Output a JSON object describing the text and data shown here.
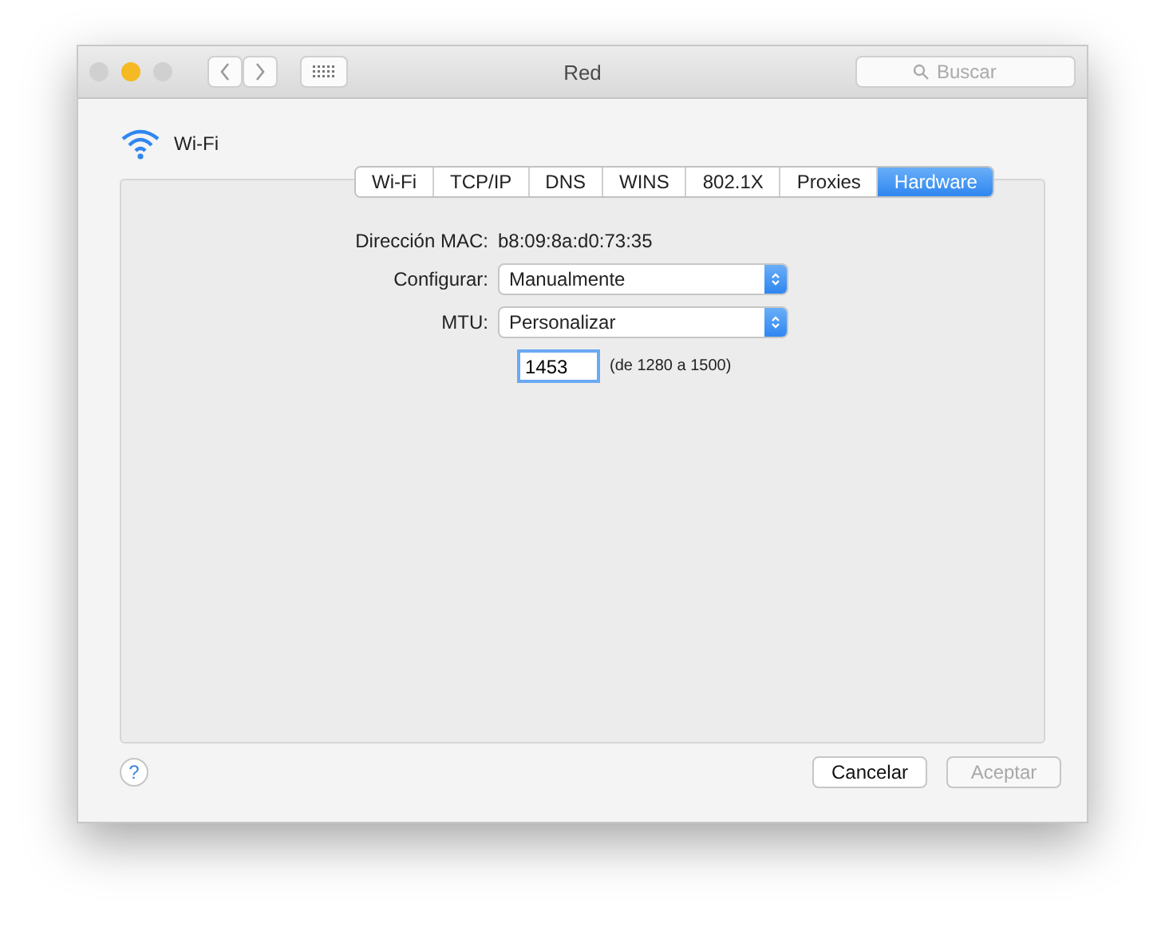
{
  "window": {
    "title": "Red",
    "traffic_lights": [
      {
        "color": "#d0d0d0"
      },
      {
        "color": "#f5b923"
      },
      {
        "color": "#d0d0d0"
      }
    ],
    "search": {
      "placeholder": "Buscar"
    }
  },
  "header": {
    "title": "Wi-Fi"
  },
  "tabs": [
    {
      "label": "Wi-Fi",
      "selected": false
    },
    {
      "label": "TCP/IP",
      "selected": false
    },
    {
      "label": "DNS",
      "selected": false
    },
    {
      "label": "WINS",
      "selected": false
    },
    {
      "label": "802.1X",
      "selected": false
    },
    {
      "label": "Proxies",
      "selected": false
    },
    {
      "label": "Hardware",
      "selected": true
    }
  ],
  "rows": [
    {
      "kind": "text",
      "label": "Dirección MAC:",
      "value": "b8:09:8a:d0:73:35"
    },
    {
      "kind": "popup",
      "label": "Configurar:",
      "value": "Manualmente"
    },
    {
      "kind": "popup",
      "label": "MTU:",
      "value": "Personalizar"
    },
    {
      "kind": "field",
      "value": "1453",
      "hint": "(de 1280 a 1500)"
    }
  ],
  "help": {
    "label": "?"
  },
  "buttons": [
    {
      "label": "Cancelar",
      "disabled": false
    },
    {
      "label": "Aceptar",
      "disabled": true
    }
  ]
}
